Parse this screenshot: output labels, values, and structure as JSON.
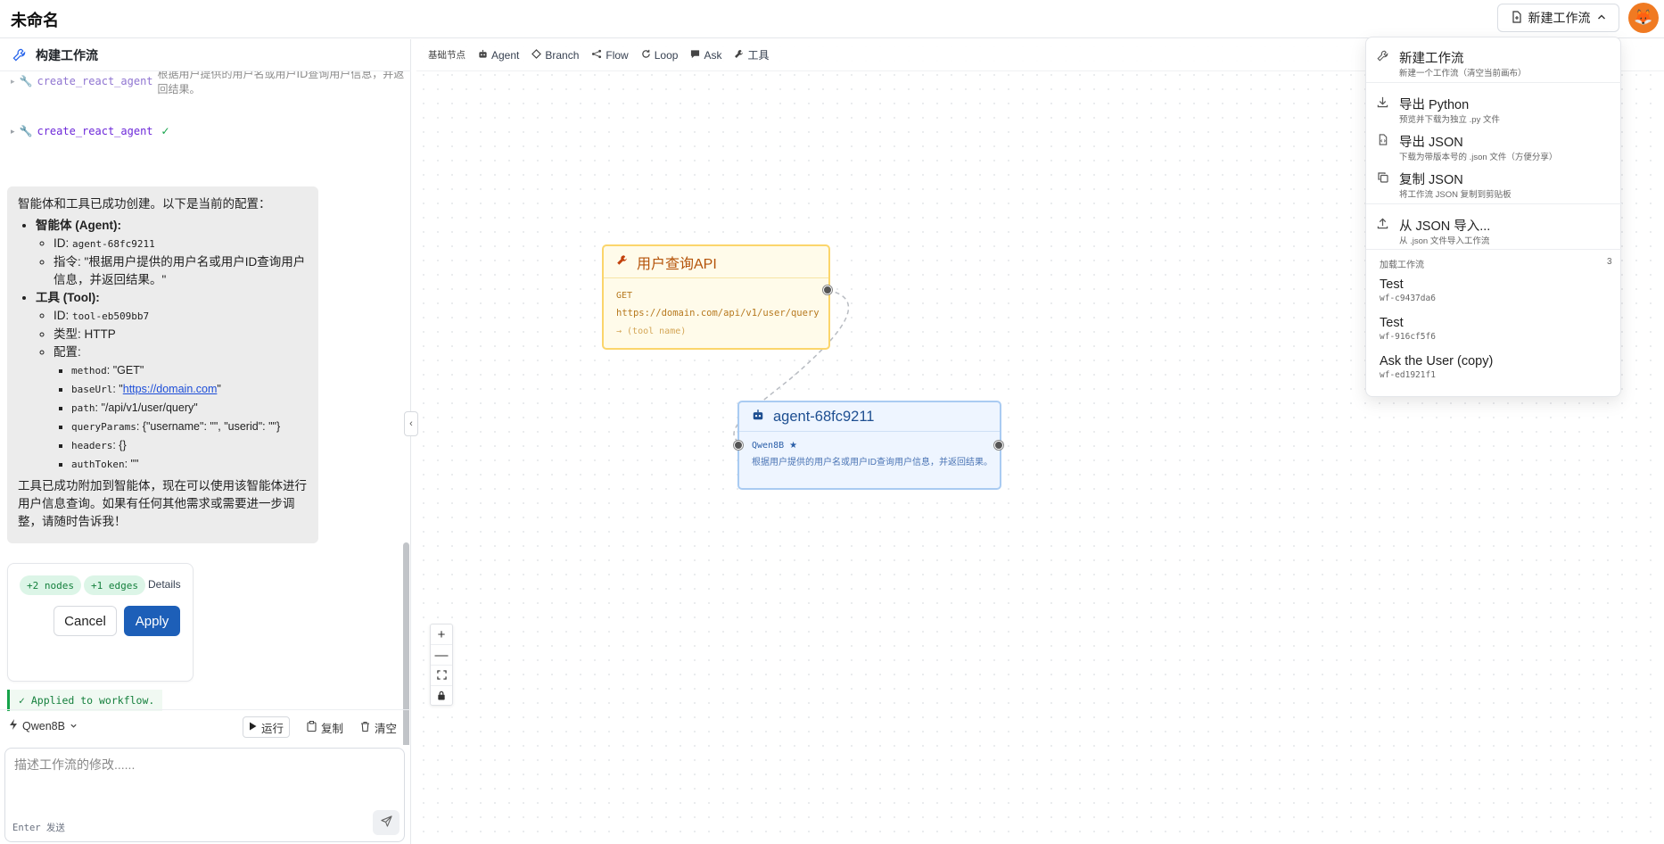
{
  "app": {
    "title": "未命名",
    "new_workflow_label": "新建工作流"
  },
  "left": {
    "header_title": "构建工作流",
    "cut_row_name": "create_react_agent",
    "cut_row_rest": "根据用户提供的用户名或用户ID查询用户信息，并返回结果。",
    "tool_call_name": "create_react_agent",
    "tool_call_status": "✓",
    "message": {
      "intro": "智能体和工具已成功创建。以下是当前的配置：",
      "agent_heading": "智能体 (Agent):",
      "agent_id_label": "ID: ",
      "agent_id": "agent-68fc9211",
      "agent_instr_label": "指令: ",
      "agent_instr": "\"根据用户提供的用户名或用户ID查询用户信息，并返回结果。\"",
      "tool_heading": "工具 (Tool):",
      "tool_id_label": "ID: ",
      "tool_id": "tool-eb509bb7",
      "tool_type": "类型: HTTP",
      "tool_config": "配置:",
      "cfg_method_k": "method",
      "cfg_method_v": ": \"GET\"",
      "cfg_base_k": "baseUrl",
      "cfg_base_pre": ": \"",
      "cfg_base_link": "https://domain.com",
      "cfg_base_post": "\"",
      "cfg_path_k": "path",
      "cfg_path_v": ": \"/api/v1/user/query\"",
      "cfg_query_k": "queryParams",
      "cfg_query_v": ": {\"username\": \"\", \"userid\": \"\"}",
      "cfg_headers_k": "headers",
      "cfg_headers_v": ": {}",
      "cfg_auth_k": "authToken",
      "cfg_auth_v": ": \"\"",
      "outro": "工具已成功附加到智能体，现在可以使用该智能体进行用户信息查询。如果有任何其他需求或需要进一步调整，请随时告诉我！"
    },
    "diff": {
      "nodes_chip": "+2 nodes",
      "edges_chip": "+1 edges",
      "details": "Details",
      "cancel": "Cancel",
      "apply": "Apply"
    },
    "applied_note": "✓ Applied to workflow.",
    "toolbar": {
      "model": "Qwen8B",
      "run": "运行",
      "copy": "复制",
      "clear": "清空"
    },
    "composer": {
      "placeholder": "描述工作流的修改......",
      "hint": "Enter 发送"
    }
  },
  "palette": [
    "基础节点",
    "Agent",
    "Branch",
    "Flow",
    "Loop",
    "Ask",
    "工具"
  ],
  "nodes": {
    "tool": {
      "title": "用户查询API",
      "method": "GET",
      "url": "https://domain.com/api/v1/user/query",
      "name_hint": "→ (tool name)"
    },
    "agent": {
      "title": "agent-68fc9211",
      "model": "Qwen8B",
      "star": "★",
      "desc": "根据用户提供的用户名或用户ID查询用户信息，并返回结果。"
    }
  },
  "zoom": [
    "+",
    "—",
    "⛶",
    "🔒"
  ],
  "dropdown": {
    "items": [
      {
        "title": "新建工作流",
        "sub": "新建一个工作流（清空当前画布）",
        "icon": "wrench-icon"
      },
      {
        "title": "导出 Python",
        "sub": "预览并下载为独立 .py 文件",
        "icon": "download-icon"
      },
      {
        "title": "导出 JSON",
        "sub": "下载为带版本号的 .json 文件（方便分享）",
        "icon": "file-json-icon"
      },
      {
        "title": "复制 JSON",
        "sub": "将工作流 JSON 复制到剪贴板",
        "icon": "copy-icon"
      },
      {
        "title": "从 JSON 导入...",
        "sub": "从 .json 文件导入工作流",
        "icon": "upload-icon"
      }
    ],
    "section_label": "加载工作流",
    "section_count": "3",
    "workflows": [
      {
        "name": "Test",
        "id": "wf-c9437da6"
      },
      {
        "name": "Test",
        "id": "wf-916cf5f6"
      },
      {
        "name": "Ask the User (copy)",
        "id": "wf-ed1921f1"
      }
    ]
  },
  "colors": {
    "accent": "#1d5fb8",
    "tool_node": "#fbd56b",
    "agent_node": "#a9cbf2",
    "success": "#15803d"
  }
}
